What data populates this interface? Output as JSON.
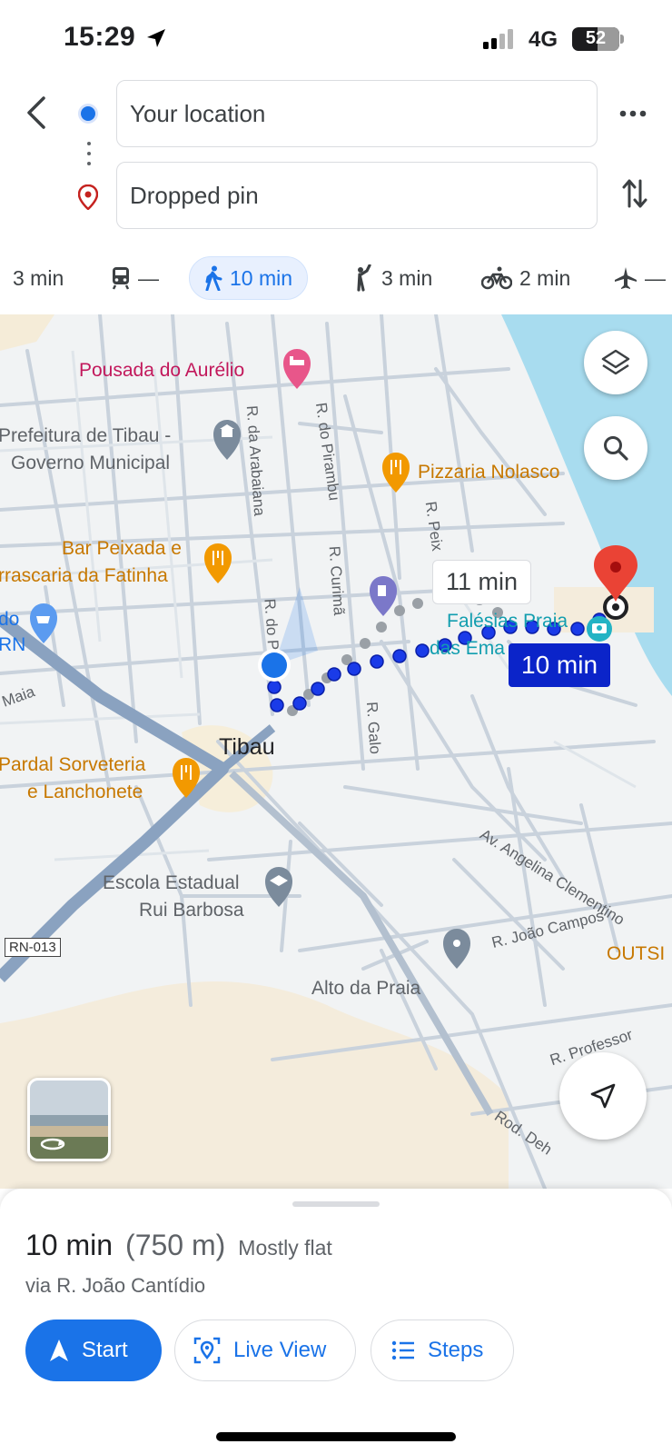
{
  "status_bar": {
    "time": "15:29",
    "network": "4G",
    "battery": "52"
  },
  "header": {
    "origin": "Your location",
    "destination": "Dropped pin"
  },
  "modes": [
    {
      "label": "3 min",
      "icon": "car-icon"
    },
    {
      "label": "—",
      "icon": "transit-icon"
    },
    {
      "label": "10 min",
      "icon": "walk-icon",
      "active": true
    },
    {
      "label": "3 min",
      "icon": "ride-hail-icon"
    },
    {
      "label": "2 min",
      "icon": "bike-icon"
    },
    {
      "label": "—",
      "icon": "flight-icon"
    }
  ],
  "map": {
    "pois": {
      "pousada": "Pousada do Aurélio",
      "prefeitura_1": "Prefeitura de Tibau -",
      "prefeitura_2": "Governo Municipal",
      "pizzaria": "Pizzaria Nolasco",
      "bar_1": "Bar Peixada e",
      "bar_2": "rrascaria da Fatinha",
      "pardal_1": "Pardal Sorveteria",
      "pardal_2": "e Lanchonete",
      "escola_1": "Escola Estadual",
      "escola_2": "Rui Barbosa",
      "alto": "Alto da Praia",
      "falesias_1": "Falésias Praia",
      "falesias_2": "das Ema",
      "outsi": "OUTSI",
      "do_rn_1": "do",
      "do_rn_2": "RN"
    },
    "streets": {
      "arabaiana": "R. da Arabaiana",
      "pirambu": "R. do Pirambu",
      "curima": "R. Curimã",
      "peix": "R. Peix",
      "do_p": "R. do P",
      "galo": "R. Galo",
      "maia": "Maia",
      "angelina": "Av. Angelina Clementino",
      "joao_campos": "R. João Campos",
      "professor": "R. Professor",
      "rod": "Rod. Deh",
      "rn013": "RN-013"
    },
    "town": "Tibau",
    "alt_route_time": "11 min",
    "main_route_time": "10 min"
  },
  "sheet": {
    "duration": "10 min",
    "distance": "(750 m)",
    "terrain": "Mostly flat",
    "via": "via R. João Cantídio",
    "start_label": "Start",
    "live_view_label": "Live View",
    "steps_label": "Steps"
  },
  "colors": {
    "route": "#1a3be8",
    "accent": "#1a73e8",
    "water": "#a8dcef",
    "road": "#c9d2dc",
    "highway": "#8aa2c0"
  }
}
